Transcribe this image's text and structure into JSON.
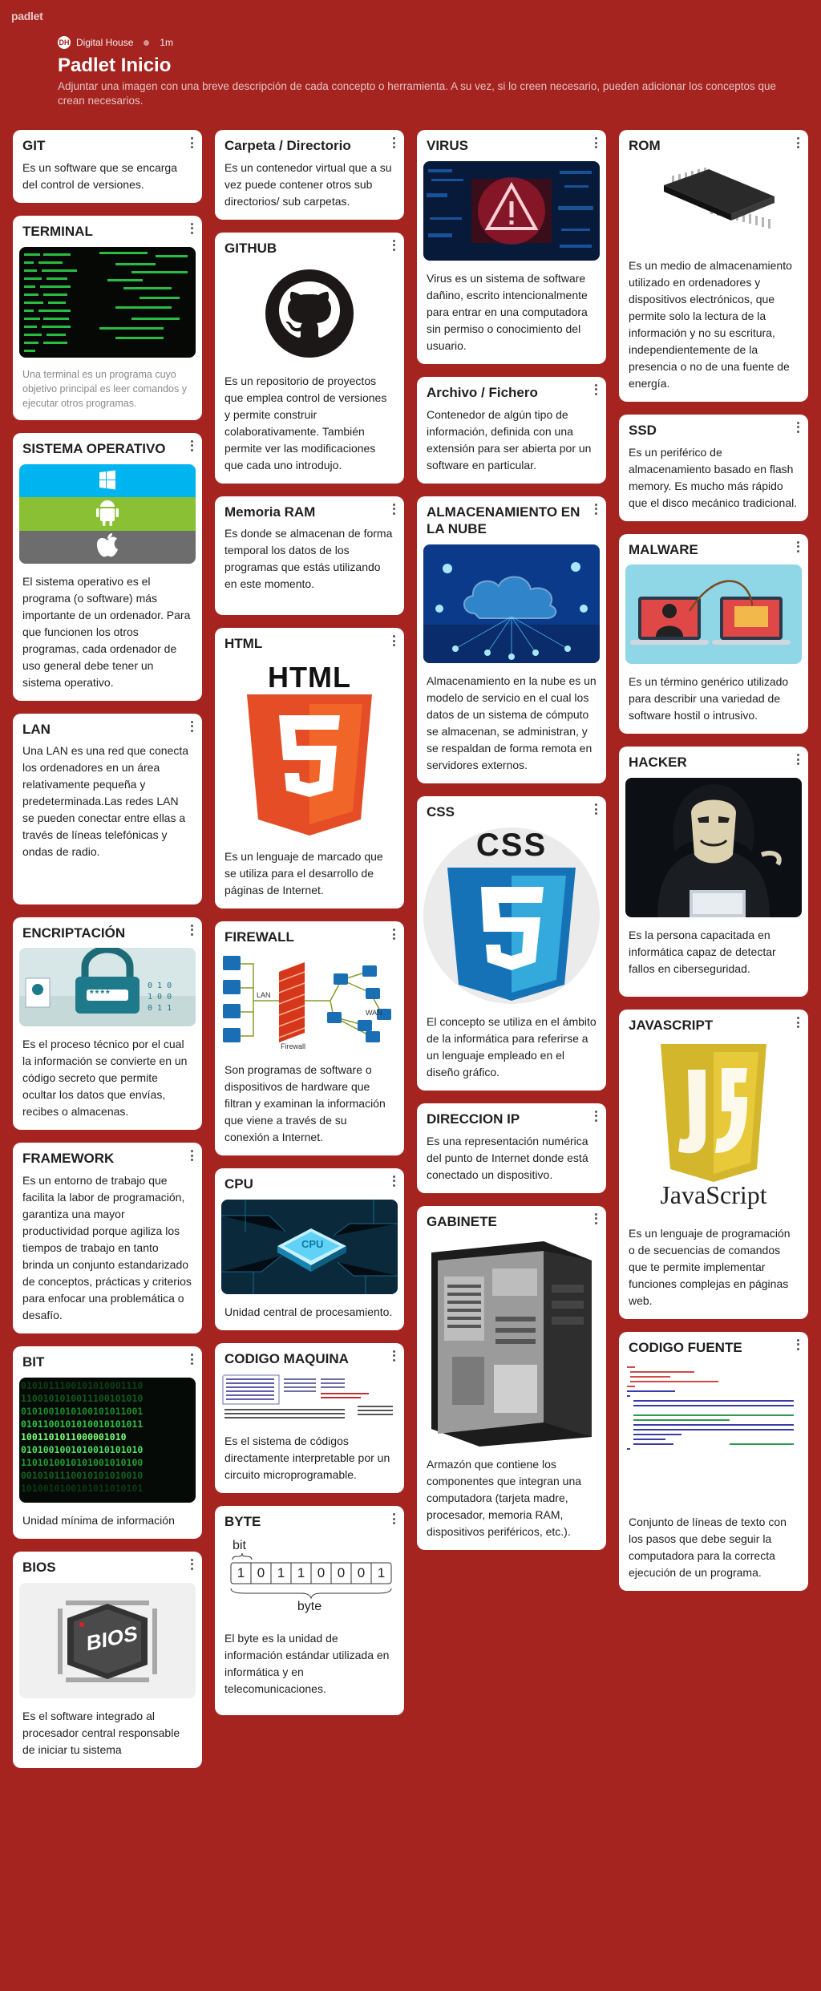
{
  "app": {
    "logo": "padlet"
  },
  "header": {
    "author": "Digital House",
    "avatar_text": "DH",
    "time": "1m",
    "title": "Padlet Inicio",
    "description": "Adjuntar una imagen con una breve descripción de cada concepto o herramienta. A su vez, si lo creen necesario, pueden adicionar los conceptos que crean necesarios."
  },
  "colors": {
    "background": "#a52420",
    "card": "#ffffff"
  },
  "columns": [
    [
      {
        "title": "GIT",
        "text": "Es un software que se encarga del control de versiones."
      },
      {
        "title": "TERMINAL",
        "text": "Una terminal es un programa cuyo objetivo principal es leer comandos y ejecutar otros programas.",
        "image": "terminal-image"
      },
      {
        "title": "SISTEMA OPERATIVO",
        "text": "El sistema operativo es el programa (o software) más importante de un ordenador. Para que funcionen los otros programas, cada ordenador de uso general debe tener un sistema operativo.",
        "image": "os-logos-image"
      },
      {
        "title": "LAN",
        "text": "Una LAN es una red que conecta los ordenadores en un área relativamente pequeña y predeterminada.Las redes LAN se pueden conectar entre ellas a través de líneas telefónicas y ondas de radio."
      },
      {
        "title": "ENCRIPTACIÓN",
        "text": "Es el proceso técnico por el cual la información se convierte en un código secreto que permite ocultar los datos que envías, recibes o almacenas.",
        "image": "encryption-image",
        "image_text": "****"
      },
      {
        "title": "FRAMEWORK",
        "text": "Es un entorno de trabajo que facilita la labor de programación, garantiza una mayor productividad porque agiliza los tiempos de trabajo en tanto brinda un conjunto estandarizado de conceptos, prácticas y criterios para enfocar una problemática o desafío."
      },
      {
        "title": "BIT",
        "text": "Unidad mínima de información",
        "image": "binary-image"
      },
      {
        "title": "BIOS",
        "text": "Es el software integrado al procesador central responsable de iniciar tu sistema",
        "image": "bios-chip-image",
        "image_text": "BIOS"
      }
    ],
    [
      {
        "title": "Carpeta / Directorio",
        "text": "Es un contenedor virtual que a su vez puede contener otros sub directorios/ sub carpetas."
      },
      {
        "title": "GITHUB",
        "text": "Es un repositorio de proyectos que emplea control de versiones y permite construir colaborativamente. También permite ver las modificaciones que cada uno introdujo.",
        "image": "github-logo-image"
      },
      {
        "title": "Memoria RAM",
        "text": "Es donde se almacenan de forma temporal los datos de los programas que estás utilizando en este momento."
      },
      {
        "title": "HTML",
        "text": "Es un lenguaje de marcado que se utiliza para el desarrollo de páginas de Internet.",
        "image": "html5-logo-image",
        "image_text": "HTML"
      },
      {
        "title": "FIREWALL",
        "text": "Son programas de software o dispositivos de hardware que filtran y examinan la información que viene a través de su conexión a Internet.",
        "image": "firewall-diagram-image",
        "image_labels": [
          "LAN",
          "WAN",
          "Firewall"
        ]
      },
      {
        "title": "CPU",
        "text": "Unidad central de procesamiento.",
        "image": "cpu-image",
        "image_text": "CPU"
      },
      {
        "title": "CODIGO MAQUINA",
        "text": "Es el sistema de códigos directamente interpretable por un circuito microprogramable.",
        "image": "machine-code-image"
      },
      {
        "title": "BYTE",
        "text": "El byte es la unidad de información estándar utilizada en informática y en telecomunicaciones.",
        "image": "byte-diagram-image",
        "image_data": {
          "bit_label": "bit",
          "bits": [
            "1",
            "0",
            "1",
            "1",
            "0",
            "0",
            "0",
            "1"
          ],
          "byte_label": "byte"
        }
      }
    ],
    [
      {
        "title": "VIRUS",
        "text": "Virus es un sistema de software dañino, escrito intencionalmente para entrar en una computadora sin permiso o conocimiento del usuario.",
        "image": "virus-warning-image"
      },
      {
        "title": "Archivo / Fichero",
        "text": "Contenedor de algún tipo de información, definida con una extensión para ser abierta por un software en particular."
      },
      {
        "title": "ALMACENAMIENTO EN LA NUBE",
        "text": "Almacenamiento en la nube es un modelo de servicio en el cual los datos de un sistema de cómputo se almacenan, se administran, y se respaldan de forma remota en servidores externos.",
        "image": "cloud-image"
      },
      {
        "title": "CSS",
        "text": "El concepto se utiliza en el ámbito de la informática para referirse a un lenguaje empleado en el diseño gráfico.",
        "image": "css3-logo-image",
        "image_text": "CSS"
      },
      {
        "title": "DIRECCION IP",
        "text": "Es una representación numérica del punto de Internet donde está conectado un dispositivo."
      },
      {
        "title": "GABINETE",
        "text": "Armazón que contiene los componentes que integran una computadora (tarjeta madre, procesador, memoria RAM, dispositivos periféricos, etc.).",
        "image": "pc-case-image"
      }
    ],
    [
      {
        "title": "ROM",
        "text": "Es un medio de almacenamiento utilizado en ordenadores y dispositivos electrónicos, que permite solo la lectura de la información y no su escritura, independientemente de la presencia o no de una fuente de energía.",
        "image": "rom-chip-image"
      },
      {
        "title": "SSD",
        "text": "Es un periférico de almacenamiento basado en flash memory. Es mucho más rápido que el disco mecánico tradicional."
      },
      {
        "title": "MALWARE",
        "text": "Es un término genérico utilizado para describir una variedad de software hostil o intrusivo.",
        "image": "malware-image"
      },
      {
        "title": "HACKER",
        "text": "Es la persona capacitada en informática capaz de detectar fallos en ciberseguridad.",
        "image": "hacker-image"
      },
      {
        "title": "JAVASCRIPT",
        "text": "Es un lenguaje de programación o de secuencias de comandos que te permite implementar funciones complejas en páginas web.",
        "image": "javascript-logo-image",
        "image_text": "JavaScript"
      },
      {
        "title": "CODIGO FUENTE",
        "text": "Conjunto de líneas de texto con los pasos que debe seguir la computadora para la correcta ejecución de un programa.",
        "image": "source-code-image"
      }
    ]
  ]
}
